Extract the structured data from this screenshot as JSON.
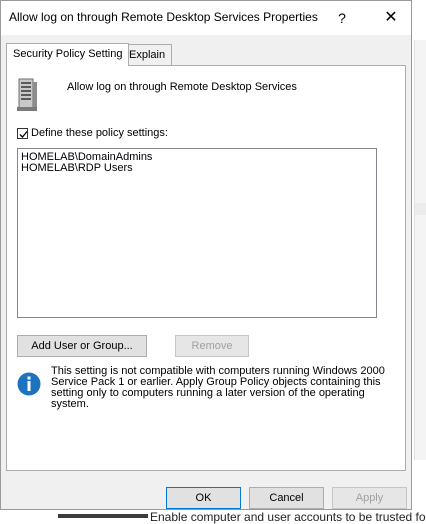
{
  "background": {
    "partial_text": "Enable computer and user accounts to be trusted fo"
  },
  "dialog": {
    "title": "Allow log on through Remote Desktop Services Properties",
    "help_glyph": "?",
    "close_glyph": "✕"
  },
  "tabs": [
    {
      "label": "Security Policy Setting",
      "active": true
    },
    {
      "label": "Explain",
      "active": false
    }
  ],
  "policy": {
    "name": "Allow log on through Remote Desktop Services",
    "icon": "server-policy-icon"
  },
  "define": {
    "label": "Define these policy settings:",
    "checked": true
  },
  "members": [
    "HOMELAB\\DomainAdmins",
    "HOMELAB\\RDP Users"
  ],
  "buttons": {
    "add": "Add User or Group...",
    "remove": "Remove",
    "ok": "OK",
    "cancel": "Cancel",
    "apply": "Apply"
  },
  "info": {
    "icon": "info-icon",
    "text": "This setting is not compatible with computers running Windows 2000 Service Pack 1 or earlier.  Apply Group Policy objects containing this setting only to computers running a later version of the operating system."
  },
  "colors": {
    "accent": "#0078d7",
    "info_blue": "#1e73be"
  }
}
